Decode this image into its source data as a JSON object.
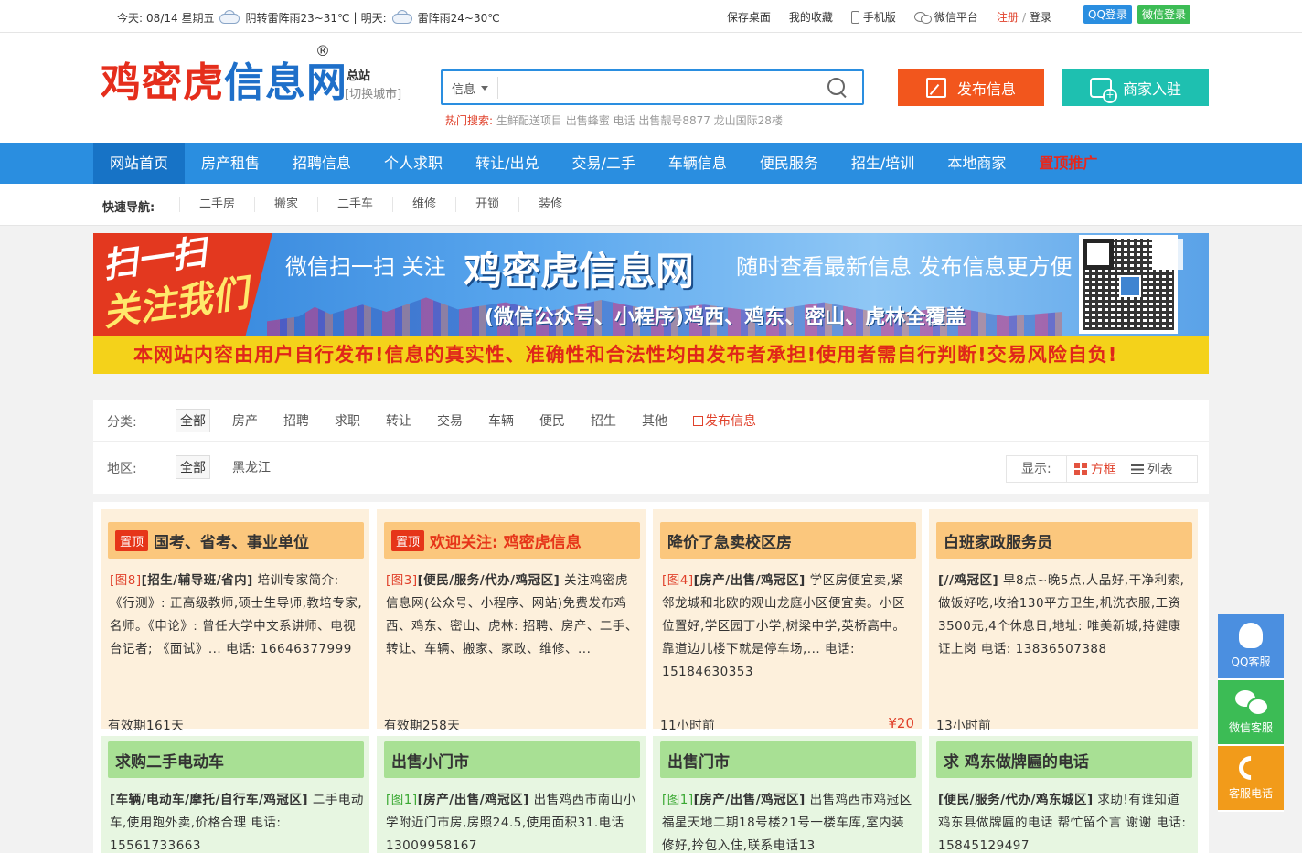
{
  "topbar": {
    "today_label": "今天:",
    "today_date": "08/14 星期五",
    "today_weather": "阴转雷阵雨23~31℃",
    "sep": "|",
    "tomorrow_label": "明天:",
    "tomorrow_weather": "雷阵雨24~30℃",
    "links": {
      "save_desktop": "保存桌面",
      "favorites": "我的收藏",
      "mobile": "手机版",
      "wechat_platform": "微信平台",
      "register": "注册",
      "slash": "/",
      "login": "登录"
    },
    "qq_login": "QQ登录",
    "wechat_login": "微信登录"
  },
  "header": {
    "logo_red": "鸡密虎",
    "logo_blue": "信息网",
    "registered_mark": "®",
    "station": "总站",
    "switch_city": "[切换城市]",
    "search": {
      "category": "信息",
      "placeholder": ""
    },
    "hot_label": "热门搜索:",
    "hot_terms": "生鲜配送项目 出售蜂蜜 电话 出售靓号8877 龙山国际28楼",
    "publish_button": "发布信息",
    "merchant_button": "商家入驻"
  },
  "nav": {
    "items": [
      "网站首页",
      "房产租售",
      "招聘信息",
      "个人求职",
      "转让/出兑",
      "交易/二手",
      "车辆信息",
      "便民服务",
      "招生/培训",
      "本地商家",
      "置顶推广"
    ]
  },
  "quick_nav": {
    "label": "快速导航:",
    "items": [
      "二手房",
      "搬家",
      "二手车",
      "维修",
      "开锁",
      "装修"
    ]
  },
  "banner": {
    "scan": "扫一扫",
    "follow": "关注我们",
    "line1": "微信扫一扫 关注",
    "big": "鸡密虎信息网",
    "line2": "随时查看最新信息 发布信息更方便",
    "line3": "(微信公众号、小程序)鸡西、鸡东、密山、虎林全覆盖",
    "notice": "本网站内容由用户自行发布!信息的真实性、准确性和合法性均由发布者承担!使用者需自行判断!交易风险自负!"
  },
  "filter": {
    "category_label": "分类:",
    "categories": [
      "全部",
      "房产",
      "招聘",
      "求职",
      "转让",
      "交易",
      "车辆",
      "便民",
      "招生",
      "其他"
    ],
    "publish_link": "发布信息",
    "region_label": "地区:",
    "regions": [
      "全部",
      "黑龙江"
    ],
    "display_label": "显示:",
    "grid_label": "方框",
    "list_label": "列表"
  },
  "cards": [
    {
      "pinned": "置顶",
      "title": "国考、省考、事业单位",
      "tag": "[图8]",
      "category": "[招生/辅导班/省内]",
      "body": " 培训专家简介: 《行测》: 正高级教师,硕士生导师,教培专家,名师。《申论》: 曾任大学中文系讲师、电视台记者; 《面试》... 电话: 16646377999",
      "footer": "有效期161天",
      "price": ""
    },
    {
      "pinned": "置顶",
      "title": "欢迎关注: 鸡密虎信息",
      "tag": "[图3]",
      "category": "[便民/服务/代办/鸡冠区]",
      "body": " 关注鸡密虎信息网(公众号、小程序、网站)免费发布鸡西、鸡东、密山、虎林: 招聘、房产、二手、转让、车辆、搬家、家政、维修、...",
      "footer": "有效期258天",
      "price": ""
    },
    {
      "pinned": "",
      "title": "降价了急卖校区房",
      "tag": "[图4]",
      "category": "[房产/出售/鸡冠区]",
      "body": " 学区房便宜卖,紧邻龙城和北欧的观山龙庭小区便宜卖。小区位置好,学区园丁小学,树梁中学,英桥高中。靠道边儿楼下就是停车场,... 电话: 15184630353",
      "footer": "11小时前",
      "price": "¥20"
    },
    {
      "pinned": "",
      "title": "白班家政服务员",
      "tag": "",
      "category": "[//鸡冠区]",
      "body": " 早8点~晚5点,人品好,干净利索,做饭好吃,收拾130平方卫生,机洗衣服,工资3500元,4个休息日,地址: 唯美新城,持健康证上岗 电话: 13836507388",
      "footer": "13小时前",
      "price": ""
    },
    {
      "pinned": "",
      "title": "求购二手电动车",
      "tag": "",
      "category": "[车辆/电动车/摩托/自行车/鸡冠区]",
      "body": " 二手电动车,使用跑外卖,价格合理 电话: 15561733663",
      "footer": "",
      "price": ""
    },
    {
      "pinned": "",
      "title": "出售小门市",
      "tag": "[图1]",
      "category": "[房产/出售/鸡冠区]",
      "body": " 出售鸡西市南山小学附近门市房,房照24.5,使用面积31.电话13009958167",
      "footer": "",
      "price": ""
    },
    {
      "pinned": "",
      "title": "出售门市",
      "tag": "[图1]",
      "category": "[房产/出售/鸡冠区]",
      "body": " 出售鸡西市鸡冠区福星天地二期18号楼21号一楼车库,室内装修好,拎包入住,联系电话13",
      "footer": "",
      "price": ""
    },
    {
      "pinned": "",
      "title": "求 鸡东做牌匾的电话",
      "tag": "",
      "category": "[便民/服务/代办/鸡东城区]",
      "body": " 求助!有谁知道鸡东县做牌匾的电话 帮忙留个言 谢谢 电话: 15845129497",
      "footer": "",
      "price": ""
    }
  ],
  "side_float": {
    "qq": "QQ客服",
    "wechat": "微信客服",
    "phone": "客服电话"
  }
}
